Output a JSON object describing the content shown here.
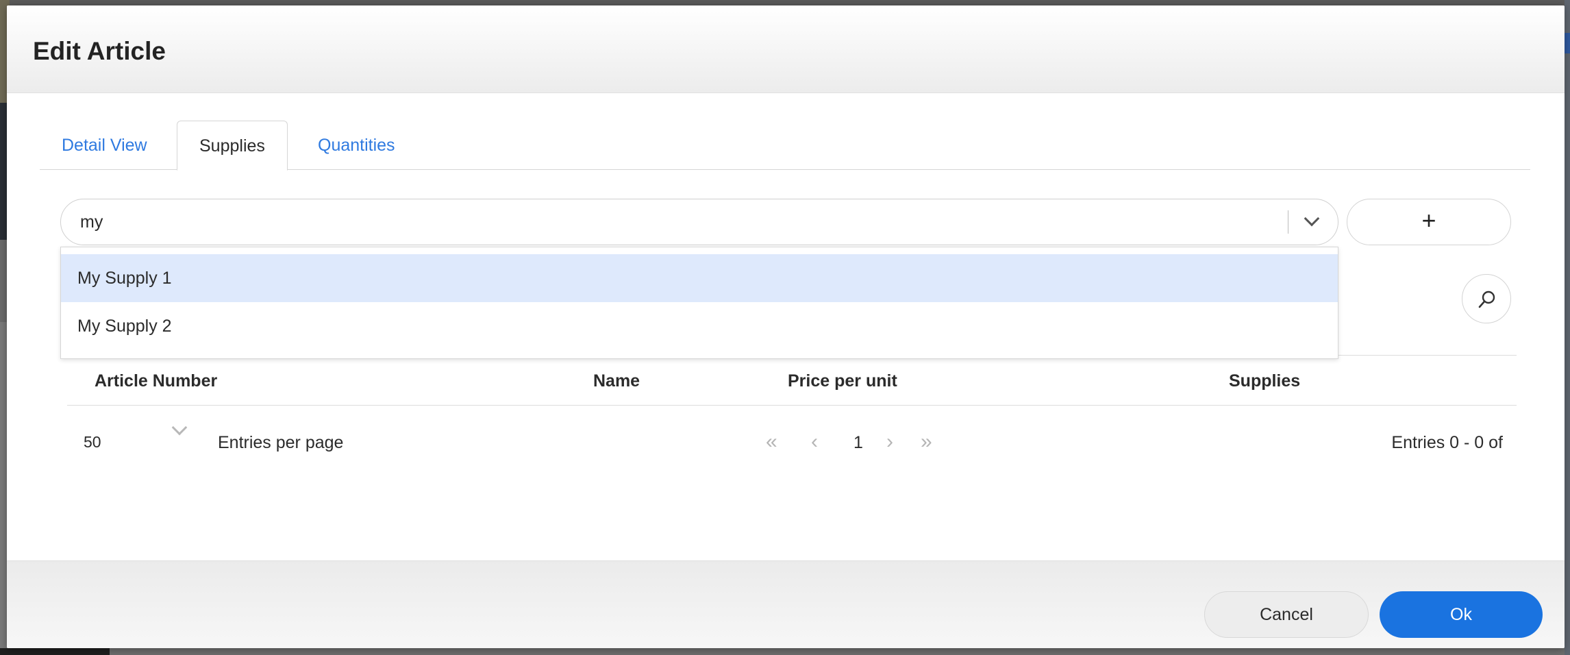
{
  "dialog": {
    "title": "Edit Article"
  },
  "tabs": [
    {
      "label": "Detail View",
      "active": false
    },
    {
      "label": "Supplies",
      "active": true
    },
    {
      "label": "Quantities",
      "active": false
    }
  ],
  "supply_combo": {
    "value": "my",
    "toggle_icon": "chevron-down-icon"
  },
  "add_button": {
    "label": "+"
  },
  "search_button": {
    "icon": "search-icon"
  },
  "dropdown": {
    "options": [
      {
        "label": "My Supply 1",
        "highlighted": true
      },
      {
        "label": "My Supply 2",
        "highlighted": false
      }
    ]
  },
  "table": {
    "columns": [
      "Article Number",
      "Name",
      "Price per unit",
      "Supplies"
    ],
    "rows": []
  },
  "pager": {
    "page_size": "50",
    "entries_per_page_label": "Entries per page",
    "first_icon": "«",
    "prev_icon": "‹",
    "current_page": "1",
    "next_icon": "›",
    "last_icon": "»",
    "entries_range": "Entries 0 - 0 of"
  },
  "footer": {
    "cancel_label": "Cancel",
    "ok_label": "Ok"
  },
  "colors": {
    "accent": "#1a73e0",
    "tab_link": "#2f7ae0",
    "highlight": "#dee9fc"
  }
}
